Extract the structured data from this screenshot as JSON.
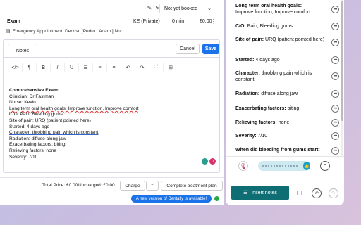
{
  "header": {
    "booking_status": "Not yet booked"
  },
  "appointment": {
    "name": "Exam",
    "payer": "KE (Private)",
    "duration": "0 min",
    "price": "£0.00",
    "description": "Emergency Appointment: Dentist: [Pedro , Adam ] Nur..."
  },
  "notes": {
    "tab_label": "Notes",
    "cancel_label": "Cancel",
    "save_label": "Save",
    "lines": [
      "Comprehensive Exam:",
      "Clinician: Dr Fastman",
      "Nurse: Kevin",
      "Long term oral health goals: Improve function, Improve comfort",
      "C/O: Pain, Bleeding gums",
      "Site of pain: URQ (patient pointed here)",
      "Started: 4 days ago",
      "Character: throbbing pain which is constant",
      "Radiation: diffuse along jaw",
      "Exacerbating factors: biting",
      "Relieving factors: none",
      "Severity: 7/10"
    ],
    "badge_count": "11"
  },
  "footer": {
    "total_price": "Total Price: £0.00",
    "uncharged": "Uncharged: £0.00",
    "charge_label": "Charge",
    "complete_label": "Complete treatment plan",
    "banner": "A new version of Dentally is available!"
  },
  "assistant": {
    "items": [
      {
        "label": "Long term oral health goals:",
        "value": "Improve function, Improve comfort"
      },
      {
        "label": "C/O:",
        "value": "Pain, Bleeding gums"
      },
      {
        "label": "Site of pain:",
        "value": "URQ (patient pointed here)"
      },
      {
        "label": "Started:",
        "value": "4 days ago"
      },
      {
        "label": "Character:",
        "value": "throbbing pain which is constant"
      },
      {
        "label": "Radiation:",
        "value": "diffuse along jaw"
      },
      {
        "label": "Exacerbating factors:",
        "value": "biting"
      },
      {
        "label": "Relieving factors:",
        "value": "none"
      },
      {
        "label": "Severity:",
        "value": "7/10"
      },
      {
        "label": "When did bleeding from gums start:",
        "value": ""
      }
    ],
    "insert_label": "Insert notes"
  },
  "colors": {
    "primary": "#1a73e8",
    "teal": "#0f6e73",
    "mic": "#b03060"
  }
}
